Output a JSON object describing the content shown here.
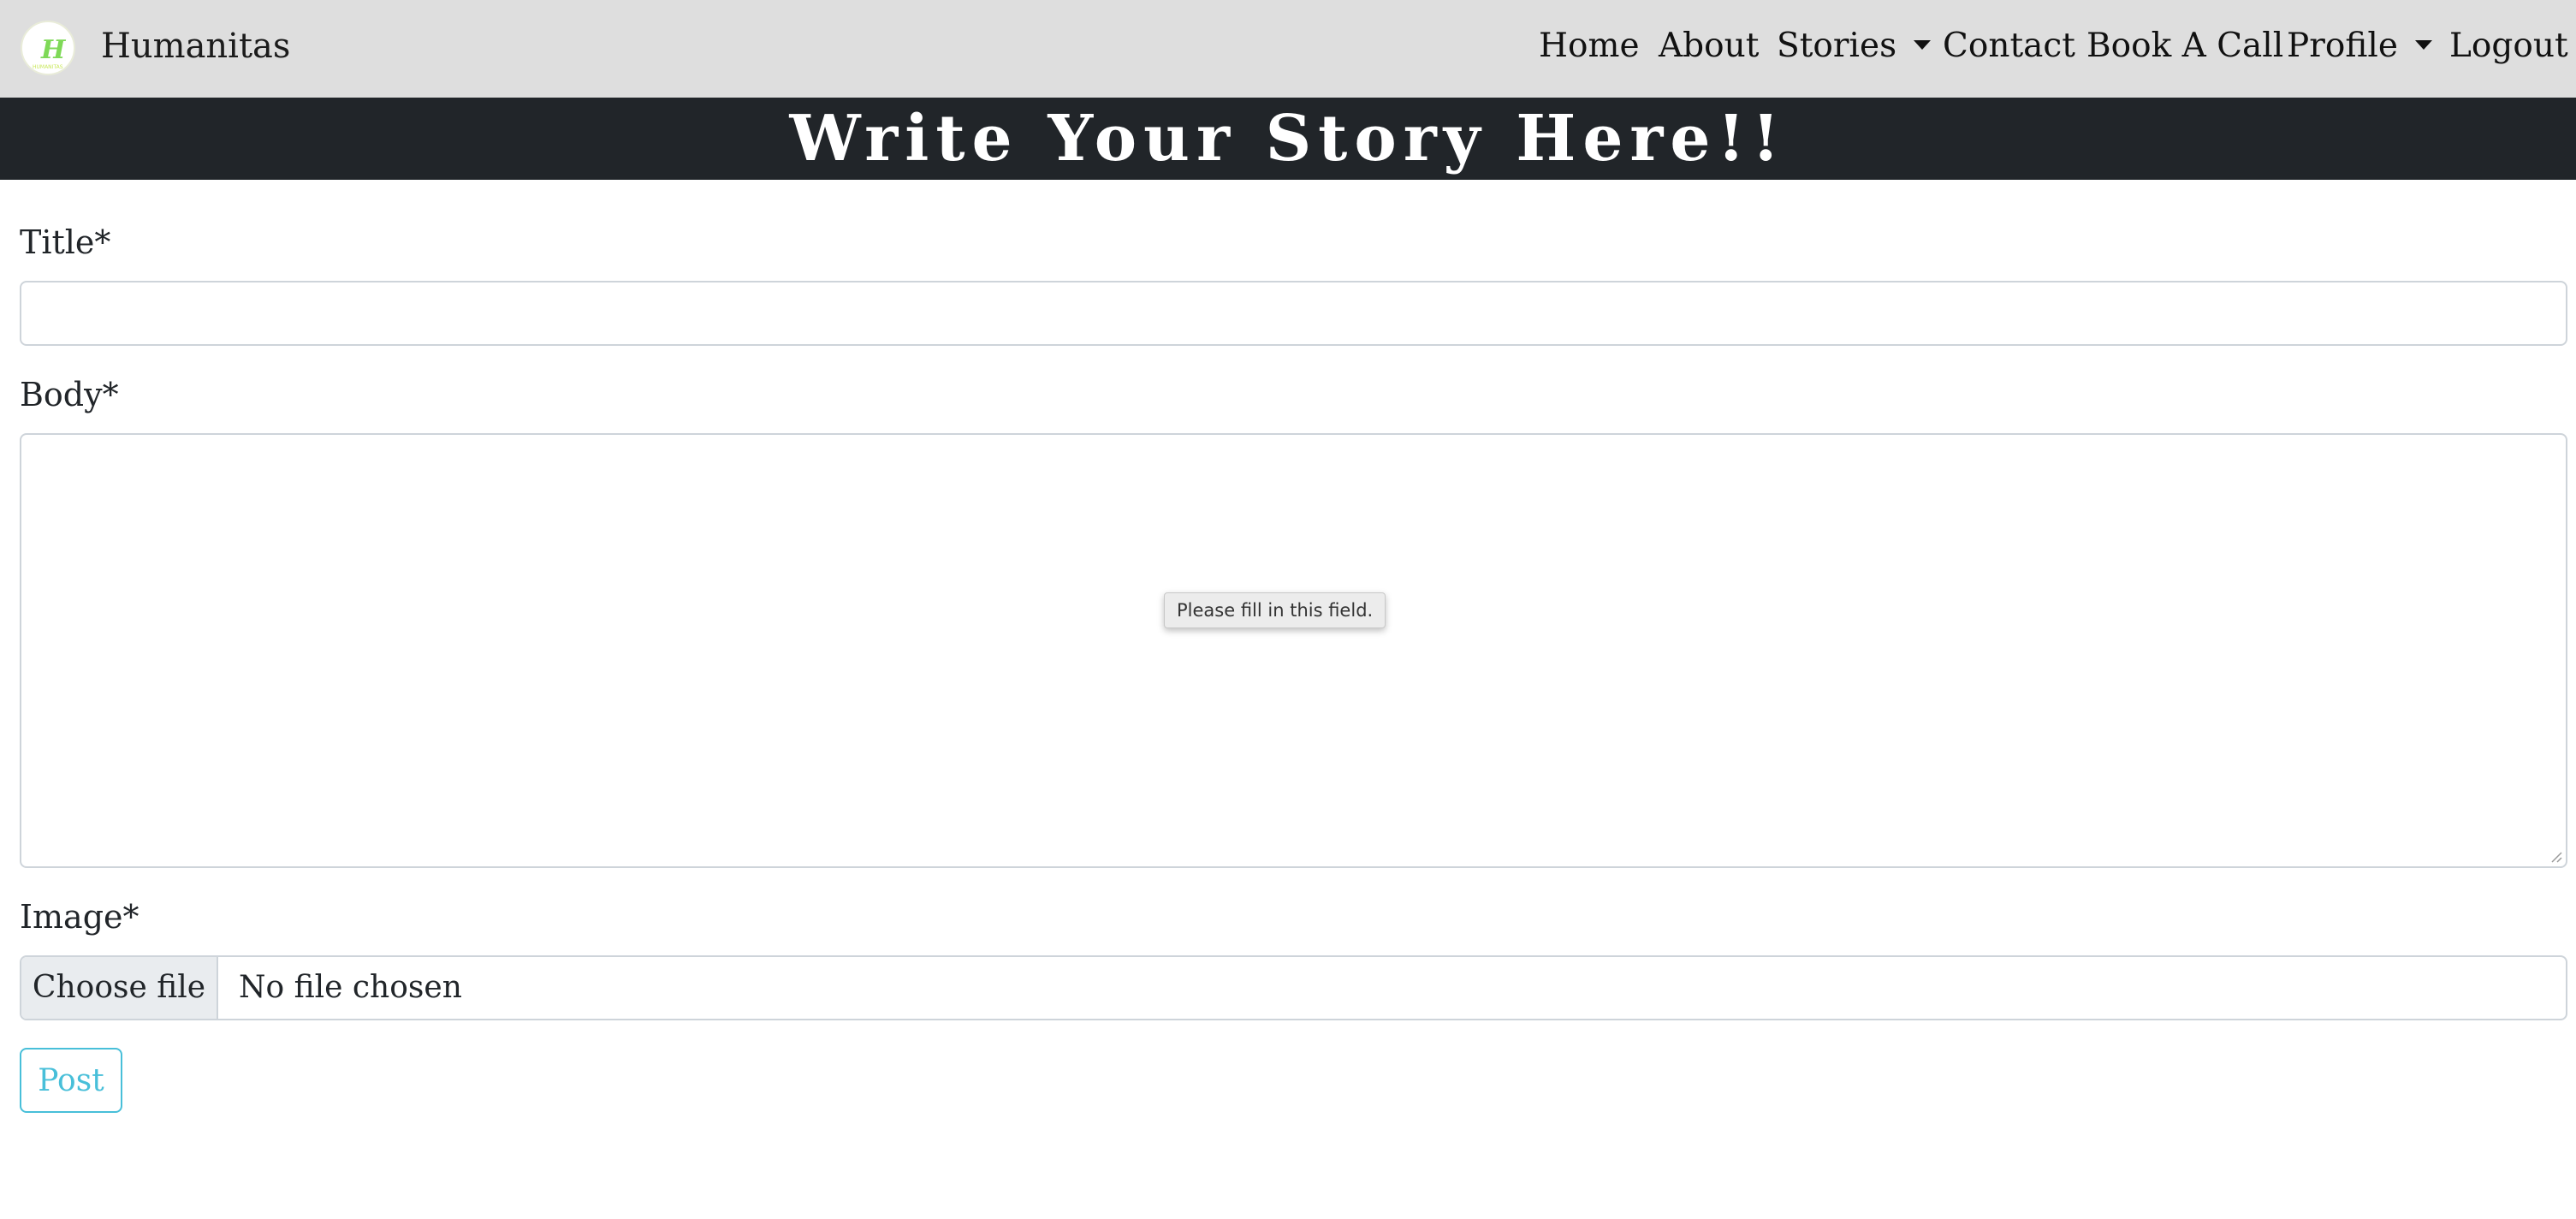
{
  "navbar": {
    "brand_name": "Humanitas",
    "logo_icon": "humanitas-h-logo-icon",
    "items": [
      {
        "label": "Home"
      },
      {
        "label": "About"
      },
      {
        "label": "Stories",
        "dropdown": true
      },
      {
        "label": "Contact"
      },
      {
        "label": "Book A Call"
      },
      {
        "label": "Profile",
        "dropdown": true
      },
      {
        "label": "Logout"
      }
    ],
    "background_color": "#dedede"
  },
  "hero": {
    "title": "Write Your Story Here!!",
    "background_color": "#212529"
  },
  "form": {
    "title_label": "Title*",
    "title_value": "",
    "body_label": "Body*",
    "body_value": "",
    "validation_tooltip": "Please fill in this field.",
    "image_label": "Image*",
    "choose_file_label": "Choose file",
    "file_status": "No file chosen",
    "post_label": "Post",
    "post_color": "#48bfd9"
  }
}
